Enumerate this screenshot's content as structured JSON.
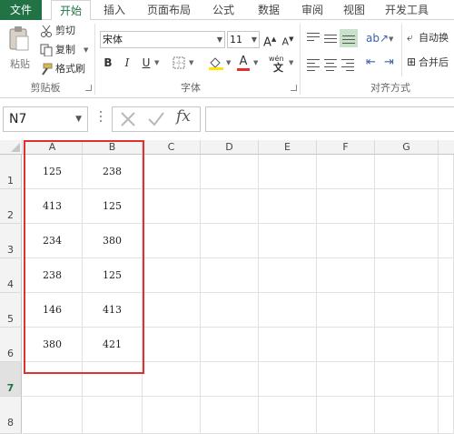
{
  "tabs": [
    "文件",
    "开始",
    "插入",
    "页面布局",
    "公式",
    "数据",
    "审阅",
    "视图",
    "开发工具"
  ],
  "clipboard": {
    "paste": "粘贴",
    "cut": "剪切",
    "copy": "复制",
    "format_painter": "格式刷",
    "label": "剪贴板"
  },
  "font": {
    "name": "宋体",
    "size": "11",
    "bold": "B",
    "italic": "I",
    "underline": "U",
    "grow": "A",
    "shrink": "A",
    "font_color": "A",
    "wen": "wén",
    "label": "字体"
  },
  "alignment": {
    "wrap": "自动换",
    "merge": "合并后",
    "label": "对齐方式"
  },
  "formula_bar": {
    "name_box": "N7",
    "fx": "fx"
  },
  "columns": [
    "A",
    "B",
    "C",
    "D",
    "E",
    "F",
    "G"
  ],
  "rows": [
    "1",
    "2",
    "3",
    "4",
    "5",
    "6",
    "7",
    "8"
  ],
  "active_row": "7",
  "cells": [
    [
      "125",
      "238"
    ],
    [
      "413",
      "125"
    ],
    [
      "234",
      "380"
    ],
    [
      "238",
      "125"
    ],
    [
      "146",
      "413"
    ],
    [
      "380",
      "421"
    ]
  ],
  "colors": {
    "accent": "#217346",
    "highlight": "#e03030"
  }
}
